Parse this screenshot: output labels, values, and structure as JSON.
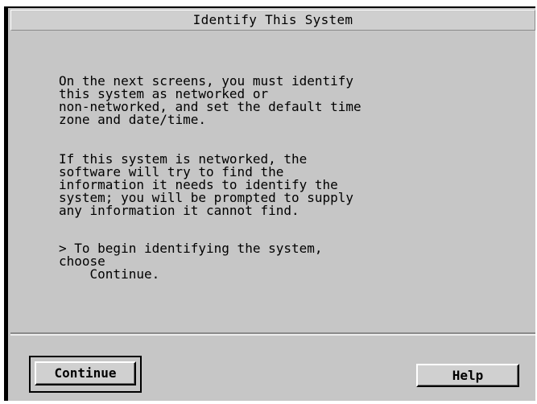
{
  "window": {
    "title": "Identify This System"
  },
  "content": {
    "paragraph_1": "On the next screens, you must identify\nthis system as networked or\nnon-networked, and set the default time\nzone and date/time.",
    "paragraph_2": "If this system is networked, the\nsoftware will try to find the\ninformation it needs to identify the\nsystem; you will be prompted to supply\nany information it cannot find.",
    "paragraph_3": "> To begin identifying the system,\nchoose\n    Continue."
  },
  "buttons": {
    "continue_label": "Continue",
    "help_label": "Help"
  },
  "colors": {
    "window_background": "#c6c6c6",
    "text": "#000000",
    "frame": "#000000"
  }
}
